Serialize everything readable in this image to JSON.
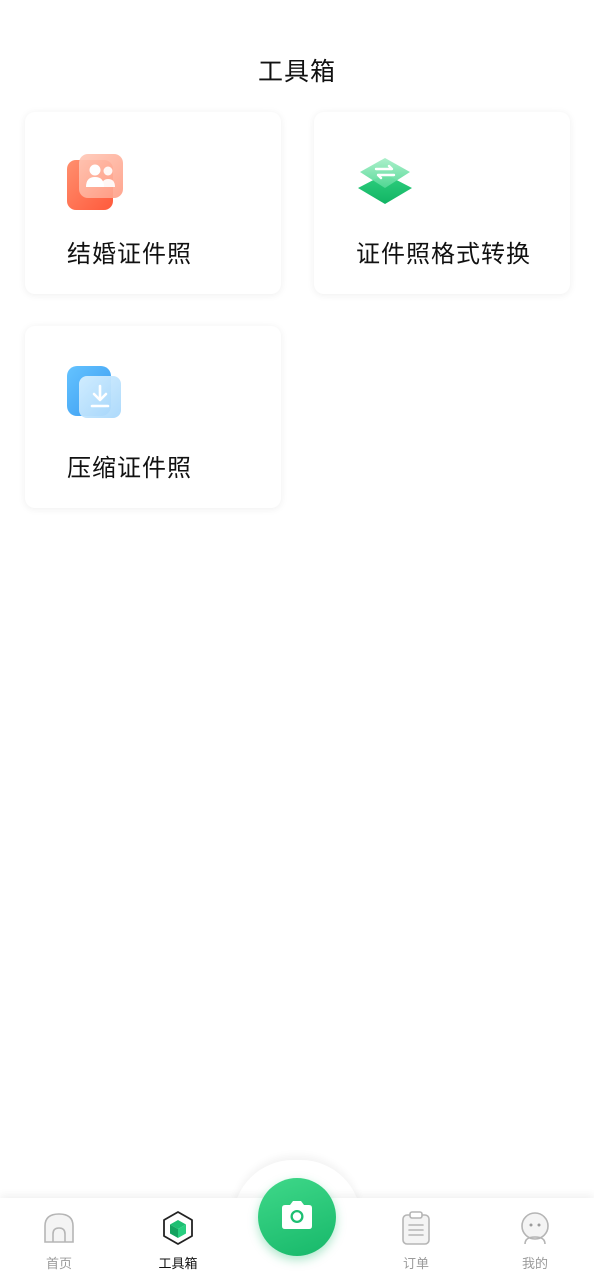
{
  "header": {
    "title": "工具箱"
  },
  "tools": [
    {
      "label": "结婚证件照",
      "icon": "couple-photo-icon"
    },
    {
      "label": "证件照格式转换",
      "icon": "format-convert-icon"
    },
    {
      "label": "压缩证件照",
      "icon": "compress-download-icon"
    }
  ],
  "tabbar": {
    "tabs": [
      {
        "label": "首页",
        "icon": "home-icon",
        "active": false
      },
      {
        "label": "工具箱",
        "icon": "toolbox-icon",
        "active": true
      },
      {
        "label": "订单",
        "icon": "order-list-icon",
        "active": false
      },
      {
        "label": "我的",
        "icon": "profile-icon",
        "active": false
      }
    ],
    "center_button": {
      "icon": "camera-icon"
    }
  },
  "colors": {
    "accent_green": "#1dbf72",
    "card_orange": "#ff7a5c",
    "card_blue": "#4aaef5",
    "tab_inactive": "#9b9b9b",
    "tab_active": "#111111"
  }
}
